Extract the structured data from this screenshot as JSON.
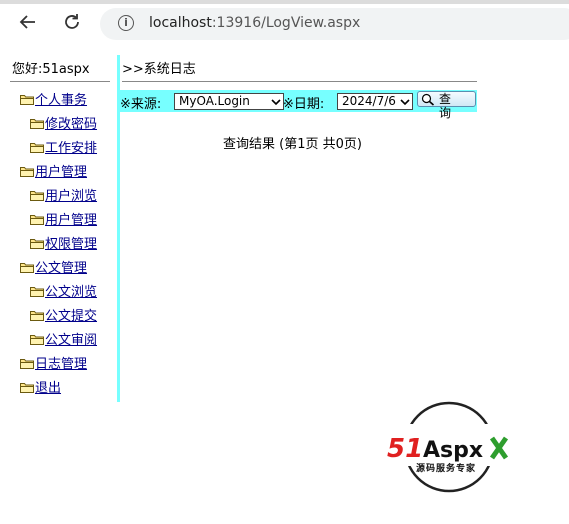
{
  "browser": {
    "back_icon": "arrow-left-icon",
    "reload_icon": "reload-icon",
    "info_icon": "info-icon",
    "url_host": "localhost",
    "url_rest": ":13916/LogView.aspx"
  },
  "sidebar": {
    "greeting": "您好:51aspx",
    "items": [
      {
        "label": "个人事务",
        "level": 0
      },
      {
        "label": "修改密码",
        "level": 1
      },
      {
        "label": "工作安排",
        "level": 1
      },
      {
        "label": "用户管理",
        "level": 0
      },
      {
        "label": "用户浏览",
        "level": 1
      },
      {
        "label": "用户管理",
        "level": 1
      },
      {
        "label": "权限管理",
        "level": 1
      },
      {
        "label": "公文管理",
        "level": 0
      },
      {
        "label": "公文浏览",
        "level": 1
      },
      {
        "label": "公文提交",
        "level": 1
      },
      {
        "label": "公文审阅",
        "level": 1
      },
      {
        "label": "日志管理",
        "level": 0
      },
      {
        "label": "退出",
        "level": 0
      }
    ]
  },
  "main": {
    "breadcrumb": ">>系统日志",
    "filter": {
      "source_label": "※来源:",
      "source_value": "MyOA.Login",
      "date_label": "※日期:",
      "date_value": "2024/7/6",
      "query_button": "查 询"
    },
    "result_text": "查询结果 (第1页 共0页)"
  },
  "logo": {
    "brand_num": "51",
    "brand_text": "Aspx",
    "tagline": "源码服务专家"
  },
  "colors": {
    "accent_cyan": "#77ffff",
    "link": "#00008b",
    "logo_red": "#e02020",
    "logo_green": "#2e9e2e"
  }
}
